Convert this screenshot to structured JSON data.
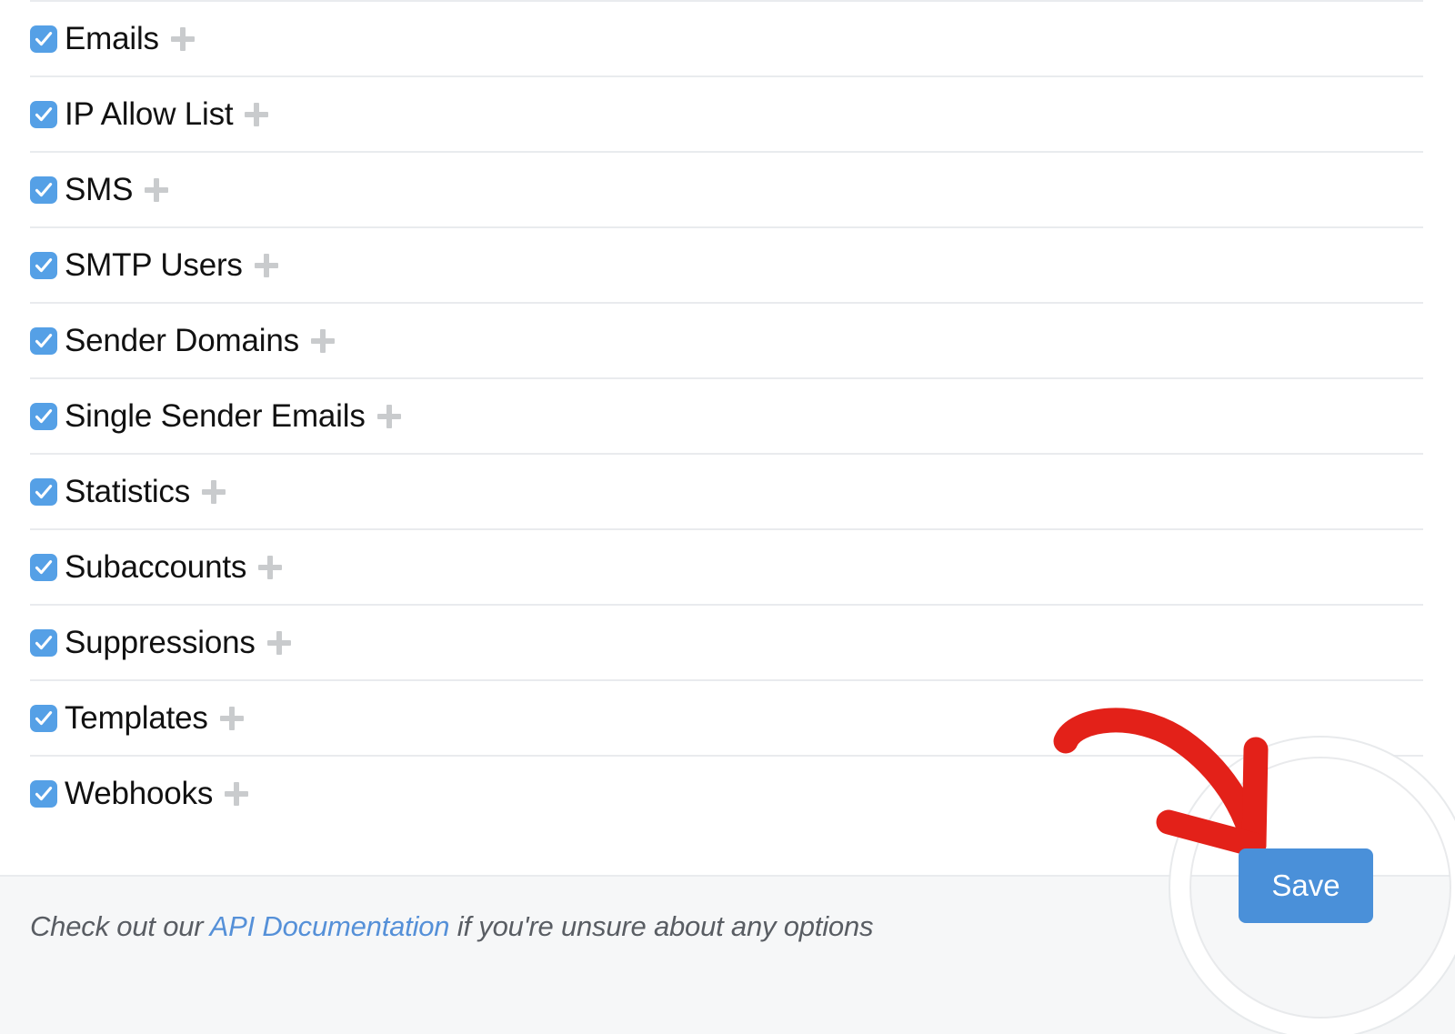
{
  "permissions": {
    "rows": [
      {
        "label": "Emails",
        "checked": true,
        "add_icon": "plus-icon"
      },
      {
        "label": "IP Allow List",
        "checked": true,
        "add_icon": "plus-icon"
      },
      {
        "label": "SMS",
        "checked": true,
        "add_icon": "plus-icon"
      },
      {
        "label": "SMTP Users",
        "checked": true,
        "add_icon": "plus-icon"
      },
      {
        "label": "Sender Domains",
        "checked": true,
        "add_icon": "plus-icon"
      },
      {
        "label": "Single Sender Emails",
        "checked": true,
        "add_icon": "plus-icon"
      },
      {
        "label": "Statistics",
        "checked": true,
        "add_icon": "plus-icon"
      },
      {
        "label": "Subaccounts",
        "checked": true,
        "add_icon": "plus-icon"
      },
      {
        "label": "Suppressions",
        "checked": true,
        "add_icon": "plus-icon"
      },
      {
        "label": "Templates",
        "checked": true,
        "add_icon": "plus-icon"
      },
      {
        "label": "Webhooks",
        "checked": true,
        "add_icon": "plus-icon"
      }
    ],
    "checkbox_icon": "check-icon",
    "checkbox_color": "#55a0e6"
  },
  "footer": {
    "note_prefix": "Check out our ",
    "link_label": "API Documentation",
    "note_suffix": " if you're unsure about any options",
    "link_color": "#5590d8",
    "background": "#f6f7f8"
  },
  "toolbar": {
    "save_label": "Save",
    "save_color": "#4a90d9"
  },
  "annotation": {
    "arrow_icon": "curved-arrow-icon",
    "arrow_color": "#e32119",
    "spotlight_icon": "circular-highlight",
    "spotlight_ring_color": "#ffffff"
  }
}
